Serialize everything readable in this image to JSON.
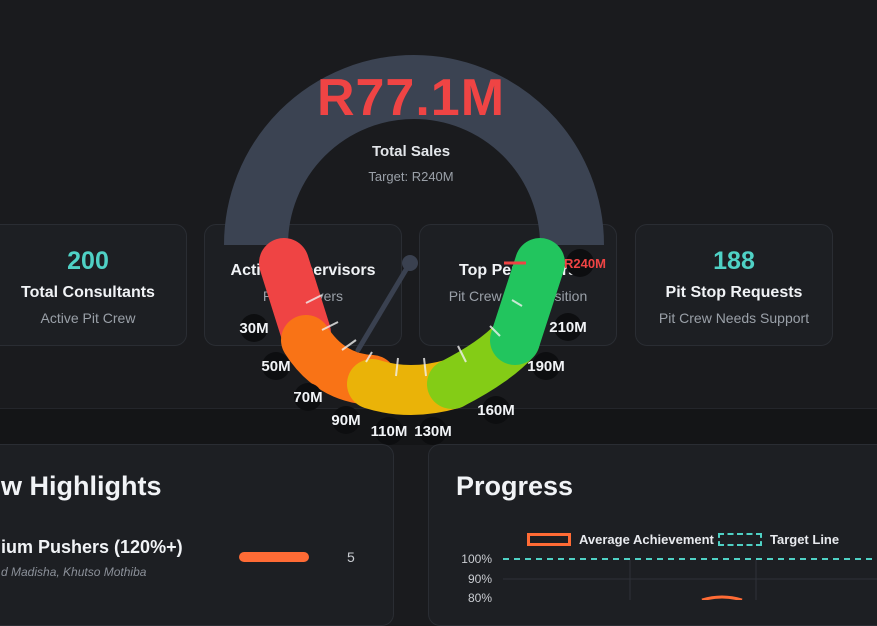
{
  "gauge": {
    "value_text": "R77.1M",
    "title": "Total Sales",
    "target_text": "Target: R240M",
    "target_marker_label": "R240M",
    "value": 77.1,
    "min": 0,
    "max": 240,
    "ticks": [
      "30M",
      "50M",
      "70M",
      "90M",
      "110M",
      "130M",
      "160M",
      "190M",
      "210M"
    ],
    "colors": {
      "track": "#3b4352",
      "red": "#ef4444",
      "orange": "#f97316",
      "yellow": "#eab308",
      "lime": "#84cc16",
      "green": "#22c55e",
      "value_text": "#ef4444",
      "needle": "#3a4150"
    }
  },
  "cards": [
    {
      "value": "200",
      "label": "Total Consultants",
      "sub": "Active Pit Crew"
    },
    {
      "value": "",
      "label": "Active Supervisors",
      "sub": "Pace Drivers"
    },
    {
      "value": "",
      "label": "Top Performers",
      "sub": "Pit Crew Pole Position"
    },
    {
      "value": "188",
      "label": "Pit Stop Requests",
      "sub": "Pit Crew Needs Support"
    }
  ],
  "highlights": {
    "title": "w Highlights",
    "item_title": "ium Pushers (120%+)",
    "item_names": "d Madisha, Khutso Mothiba",
    "item_count": "5",
    "bar_color": "#ff6b35"
  },
  "progress": {
    "title": "Progress",
    "legend": [
      {
        "label": "Average Achievement",
        "color": "#ff6b35",
        "style": "solid"
      },
      {
        "label": "Target Line",
        "color": "#4fd1c5",
        "style": "dashed"
      }
    ],
    "y_ticks": [
      "100%",
      "90%",
      "80%"
    ]
  }
}
